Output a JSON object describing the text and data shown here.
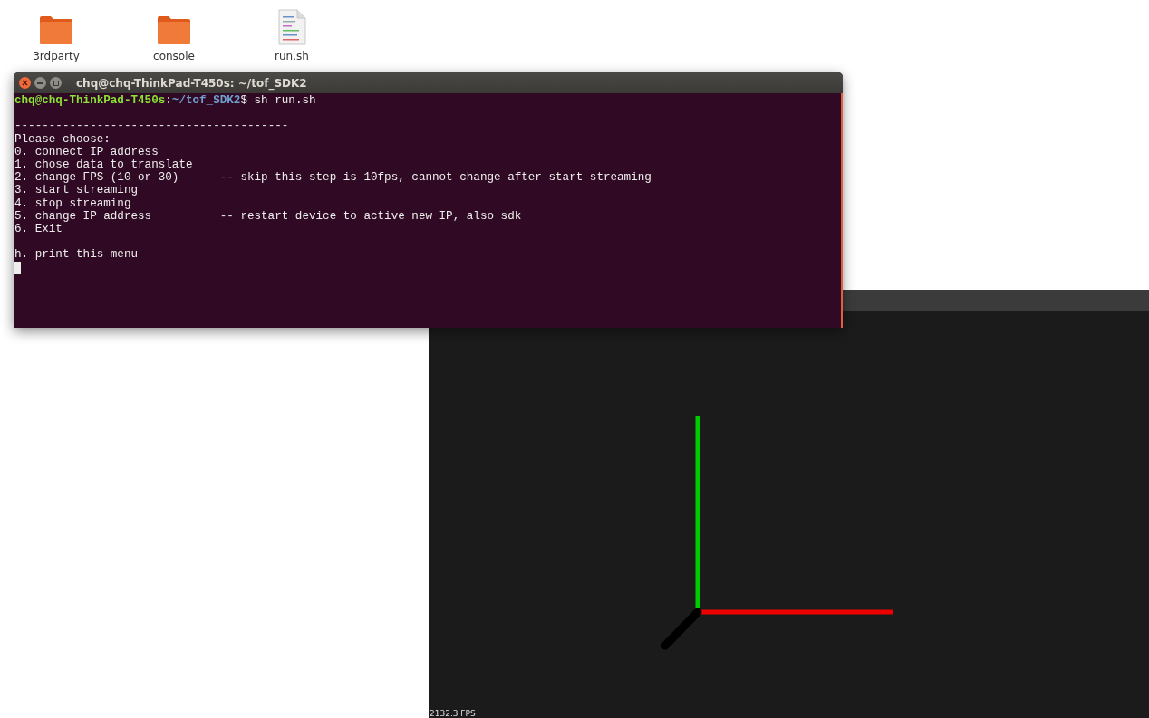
{
  "desktop_icons": [
    {
      "label": "3rdparty",
      "kind": "folder"
    },
    {
      "label": "console",
      "kind": "folder"
    },
    {
      "label": "run.sh",
      "kind": "script"
    }
  ],
  "terminal": {
    "title": "chq@chq-ThinkPad-T450s: ~/tof_SDK2",
    "prompt": {
      "user_host": "chq@chq-ThinkPad-T450s",
      "separator": ":",
      "path": "~/tof_SDK2",
      "symbol": "$",
      "command": "sh run.sh"
    },
    "separator_line": "----------------------------------------",
    "heading": "Please choose:",
    "menu_items": [
      {
        "label": "0. connect IP address"
      },
      {
        "label": "1. chose data to translate"
      },
      {
        "label": "2. change FPS (10 or 30)",
        "note": "-- skip this step is 10fps, cannot change after start streaming"
      },
      {
        "label": "3. start streaming"
      },
      {
        "label": "4. stop streaming"
      },
      {
        "label": "5. change IP address",
        "note": "-- restart device to active new IP, also sdk"
      },
      {
        "label": "6. Exit"
      }
    ],
    "help_item": "h. print this menu"
  },
  "viewer": {
    "fps": "2132.3 FPS"
  }
}
